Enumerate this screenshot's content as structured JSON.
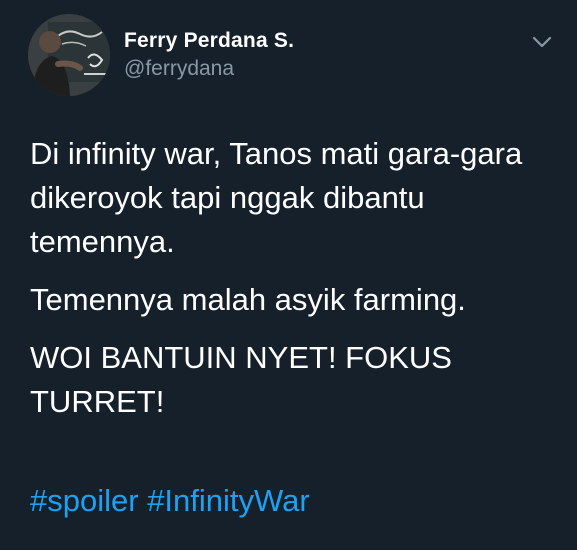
{
  "author": {
    "display_name": "Ferry Perdana S.",
    "handle": "@ferrydana"
  },
  "tweet": {
    "paragraphs": [
      "Di infinity war, Tanos mati gara-gara dikeroyok tapi nggak dibantu temennya.",
      "Temennya malah asyik farming.",
      "WOI BANTUIN NYET! FOKUS TURRET!"
    ],
    "hashtags": [
      "#spoiler",
      "#InfinityWar"
    ]
  },
  "colors": {
    "background": "#15202b",
    "text": "#ffffff",
    "secondary": "#8899a6",
    "link": "#1da1f2"
  },
  "icons": {
    "menu": "chevron-down-icon"
  }
}
